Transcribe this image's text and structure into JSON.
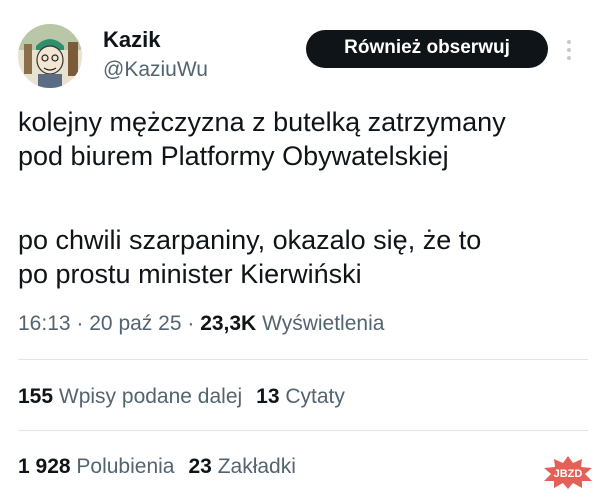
{
  "user": {
    "name": "Kazik",
    "handle": "@KaziuWu"
  },
  "follow_button": {
    "label": "Również obserwuj"
  },
  "tweet": {
    "line1": "kolejny mężczyzna z butelką zatrzymany",
    "line2": "pod biurem Platformy Obywatelskiej",
    "line3": "po chwili szarpaniny, okazalo się, że to",
    "line4": "po prostu minister Kierwiński"
  },
  "meta": {
    "time": "16:13",
    "sep": "·",
    "date": "20 paź 25",
    "views_count": "23,3K",
    "views_label": "Wyświetlenia"
  },
  "stats": {
    "reposts_count": "155",
    "reposts_label": "Wpisy podane dalej",
    "quotes_count": "13",
    "quotes_label": "Cytaty",
    "likes_count": "1 928",
    "likes_label": "Polubienia",
    "bookmarks_count": "23",
    "bookmarks_label": "Zakładki"
  },
  "watermark": {
    "text": "JBZD"
  },
  "colors": {
    "text": "#0f1419",
    "secondary": "#536471",
    "divider": "#e3e6e8",
    "watermark": "#e0453b"
  }
}
